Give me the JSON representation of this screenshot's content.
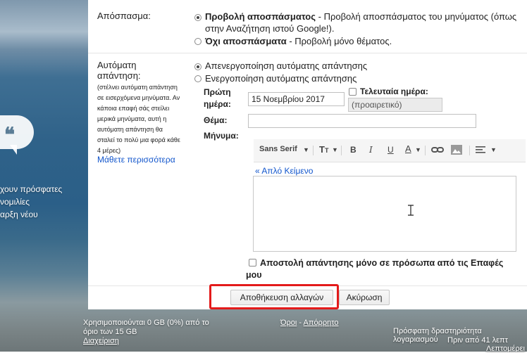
{
  "left_promo": {
    "line1": "χουν πρόσφατες",
    "line2": "νομιλίες",
    "line3": "αρξη νέου"
  },
  "snippets": {
    "label": "Απόσπασμα:",
    "opt1_bold": "Προβολή αποσπάσματος",
    "opt1_rest": " - Προβολή αποσπάσματος του μηνύματος (όπως",
    "opt1_line2": "στην Αναζήτηση ιστού Google!).",
    "opt2_bold": "Όχι αποσπάσματα",
    "opt2_rest": " - Προβολή μόνο θέματος."
  },
  "auto_reply": {
    "label_line1": "Αυτόματη",
    "label_line2": "απάντηση:",
    "note_lines": [
      "(στέλνει αυτόματη απάντηση",
      "σε εισερχόμενα μηνύματα. Αν",
      "κάποια επαφή σάς στείλει",
      "μερικά μηνύματα, αυτή η",
      "αυτόματη απάντηση θα",
      "σταλεί το πολύ μια φορά κάθε",
      "4 μέρες)"
    ],
    "learn_more": "Μάθετε περισσότερα",
    "off_label": "Απενεργοποίηση αυτόματης απάντησης",
    "on_label": "Ενεργοποίηση αυτόματης απάντησης",
    "first_day_label_1": "Πρώτη",
    "first_day_label_2": "ημέρα:",
    "first_day_value": "15 Νοεμβρίου 2017",
    "last_day_label": "Τελευταία ημέρα:",
    "last_day_placeholder": "(προαιρετικό)",
    "subject_label": "Θέμα:",
    "subject_value": "",
    "message_label": "Μήνυμα:",
    "plain_text_link": "« Απλό Κείμενο",
    "contacts_only_label": "Αποστολή απάντησης μόνο σε πρόσωπα από τις Επαφές",
    "contacts_only_label_2": "μου"
  },
  "toolbar": {
    "font": "Sans Serif",
    "size_icon": "text-size-icon",
    "bold": "B",
    "italic": "I",
    "underline": "U",
    "text_color": "A",
    "link_icon": "link-icon",
    "image_icon": "image-icon",
    "align_icon": "align-icon"
  },
  "actions": {
    "save": "Αποθήκευση αλλαγών",
    "cancel": "Ακύρωση"
  },
  "footer": {
    "storage_line1": "Χρησιμοποιούνται 0 GB (0%) από το",
    "storage_line2": "όριο των 15 GB",
    "manage": "Διαχείριση",
    "terms": "Όροι",
    "dash": " - ",
    "privacy": "Απόρρητο",
    "activity_line1": "Πρόσφατη δραστηριότητα λογαριασμού",
    "activity_line2": "Πριν από 41 λεπτ",
    "details": "Λεπτομέρει"
  },
  "colors": {
    "highlight": "#e31b1b",
    "link": "#1155cc"
  }
}
